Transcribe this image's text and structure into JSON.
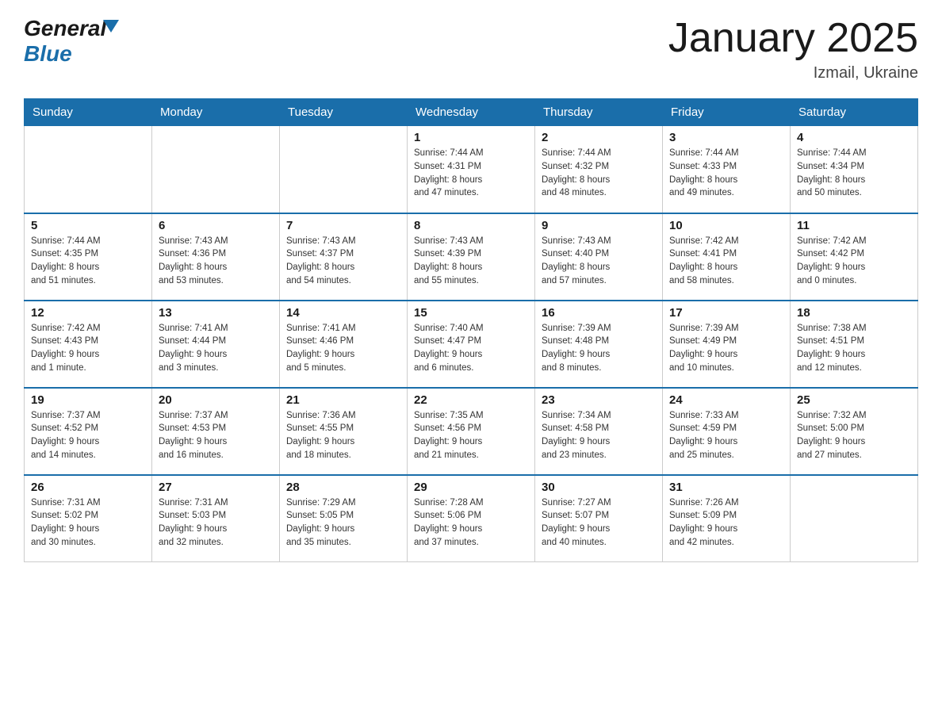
{
  "header": {
    "logo_general": "General",
    "logo_blue": "Blue",
    "month_title": "January 2025",
    "location": "Izmail, Ukraine"
  },
  "days_of_week": [
    "Sunday",
    "Monday",
    "Tuesday",
    "Wednesday",
    "Thursday",
    "Friday",
    "Saturday"
  ],
  "weeks": [
    [
      {
        "day": "",
        "info": ""
      },
      {
        "day": "",
        "info": ""
      },
      {
        "day": "",
        "info": ""
      },
      {
        "day": "1",
        "info": "Sunrise: 7:44 AM\nSunset: 4:31 PM\nDaylight: 8 hours\nand 47 minutes."
      },
      {
        "day": "2",
        "info": "Sunrise: 7:44 AM\nSunset: 4:32 PM\nDaylight: 8 hours\nand 48 minutes."
      },
      {
        "day": "3",
        "info": "Sunrise: 7:44 AM\nSunset: 4:33 PM\nDaylight: 8 hours\nand 49 minutes."
      },
      {
        "day": "4",
        "info": "Sunrise: 7:44 AM\nSunset: 4:34 PM\nDaylight: 8 hours\nand 50 minutes."
      }
    ],
    [
      {
        "day": "5",
        "info": "Sunrise: 7:44 AM\nSunset: 4:35 PM\nDaylight: 8 hours\nand 51 minutes."
      },
      {
        "day": "6",
        "info": "Sunrise: 7:43 AM\nSunset: 4:36 PM\nDaylight: 8 hours\nand 53 minutes."
      },
      {
        "day": "7",
        "info": "Sunrise: 7:43 AM\nSunset: 4:37 PM\nDaylight: 8 hours\nand 54 minutes."
      },
      {
        "day": "8",
        "info": "Sunrise: 7:43 AM\nSunset: 4:39 PM\nDaylight: 8 hours\nand 55 minutes."
      },
      {
        "day": "9",
        "info": "Sunrise: 7:43 AM\nSunset: 4:40 PM\nDaylight: 8 hours\nand 57 minutes."
      },
      {
        "day": "10",
        "info": "Sunrise: 7:42 AM\nSunset: 4:41 PM\nDaylight: 8 hours\nand 58 minutes."
      },
      {
        "day": "11",
        "info": "Sunrise: 7:42 AM\nSunset: 4:42 PM\nDaylight: 9 hours\nand 0 minutes."
      }
    ],
    [
      {
        "day": "12",
        "info": "Sunrise: 7:42 AM\nSunset: 4:43 PM\nDaylight: 9 hours\nand 1 minute."
      },
      {
        "day": "13",
        "info": "Sunrise: 7:41 AM\nSunset: 4:44 PM\nDaylight: 9 hours\nand 3 minutes."
      },
      {
        "day": "14",
        "info": "Sunrise: 7:41 AM\nSunset: 4:46 PM\nDaylight: 9 hours\nand 5 minutes."
      },
      {
        "day": "15",
        "info": "Sunrise: 7:40 AM\nSunset: 4:47 PM\nDaylight: 9 hours\nand 6 minutes."
      },
      {
        "day": "16",
        "info": "Sunrise: 7:39 AM\nSunset: 4:48 PM\nDaylight: 9 hours\nand 8 minutes."
      },
      {
        "day": "17",
        "info": "Sunrise: 7:39 AM\nSunset: 4:49 PM\nDaylight: 9 hours\nand 10 minutes."
      },
      {
        "day": "18",
        "info": "Sunrise: 7:38 AM\nSunset: 4:51 PM\nDaylight: 9 hours\nand 12 minutes."
      }
    ],
    [
      {
        "day": "19",
        "info": "Sunrise: 7:37 AM\nSunset: 4:52 PM\nDaylight: 9 hours\nand 14 minutes."
      },
      {
        "day": "20",
        "info": "Sunrise: 7:37 AM\nSunset: 4:53 PM\nDaylight: 9 hours\nand 16 minutes."
      },
      {
        "day": "21",
        "info": "Sunrise: 7:36 AM\nSunset: 4:55 PM\nDaylight: 9 hours\nand 18 minutes."
      },
      {
        "day": "22",
        "info": "Sunrise: 7:35 AM\nSunset: 4:56 PM\nDaylight: 9 hours\nand 21 minutes."
      },
      {
        "day": "23",
        "info": "Sunrise: 7:34 AM\nSunset: 4:58 PM\nDaylight: 9 hours\nand 23 minutes."
      },
      {
        "day": "24",
        "info": "Sunrise: 7:33 AM\nSunset: 4:59 PM\nDaylight: 9 hours\nand 25 minutes."
      },
      {
        "day": "25",
        "info": "Sunrise: 7:32 AM\nSunset: 5:00 PM\nDaylight: 9 hours\nand 27 minutes."
      }
    ],
    [
      {
        "day": "26",
        "info": "Sunrise: 7:31 AM\nSunset: 5:02 PM\nDaylight: 9 hours\nand 30 minutes."
      },
      {
        "day": "27",
        "info": "Sunrise: 7:31 AM\nSunset: 5:03 PM\nDaylight: 9 hours\nand 32 minutes."
      },
      {
        "day": "28",
        "info": "Sunrise: 7:29 AM\nSunset: 5:05 PM\nDaylight: 9 hours\nand 35 minutes."
      },
      {
        "day": "29",
        "info": "Sunrise: 7:28 AM\nSunset: 5:06 PM\nDaylight: 9 hours\nand 37 minutes."
      },
      {
        "day": "30",
        "info": "Sunrise: 7:27 AM\nSunset: 5:07 PM\nDaylight: 9 hours\nand 40 minutes."
      },
      {
        "day": "31",
        "info": "Sunrise: 7:26 AM\nSunset: 5:09 PM\nDaylight: 9 hours\nand 42 minutes."
      },
      {
        "day": "",
        "info": ""
      }
    ]
  ]
}
